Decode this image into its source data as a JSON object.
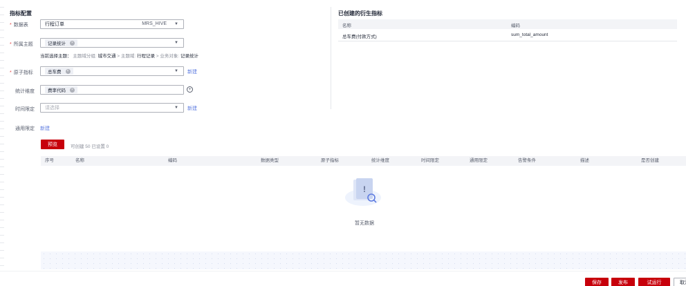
{
  "config": {
    "title": "指标配置",
    "datatable": {
      "label": "数据表",
      "value": "行程订单",
      "suffix": "MRS_HIVE"
    },
    "subject": {
      "label": "所属主题",
      "tag": "记录统计",
      "path_prefix": "当前选择主题：",
      "path": [
        {
          "k": "主题域分组:",
          "v": "城市交通"
        },
        {
          "k": "主题域:",
          "v": "行程记录"
        },
        {
          "k": "业务对象:",
          "v": "记录统计"
        }
      ]
    },
    "atomic": {
      "label": "原子指标",
      "tag": "总车费",
      "new_link": "新建"
    },
    "dimension": {
      "label": "统计维度",
      "tag": "费率代码"
    },
    "time": {
      "label": "时间限定",
      "placeholder": "请选择",
      "new_link": "新建"
    },
    "general": {
      "label": "通用限定",
      "new_link": "新建"
    },
    "preview_button": "预览",
    "count_text": "可创建 50 已设置 0"
  },
  "created": {
    "title": "已创建的衍生指标",
    "columns": [
      "名称",
      "编码"
    ],
    "rows": [
      {
        "name": "总车费(付款方式)",
        "code": "sum_total_amount"
      }
    ]
  },
  "table": {
    "columns": [
      "序号",
      "名称",
      "编码",
      "数据类型",
      "原子指标",
      "统计维度",
      "时间限定",
      "通用限定",
      "告警条件",
      "描述",
      "是否创建"
    ],
    "empty_text": "暂无数据"
  },
  "footer": {
    "save": "保存",
    "publish": "发布",
    "trial": "试运行",
    "cancel": "取消"
  },
  "colors": {
    "brand": "#c7000b",
    "link": "#5e7ce0",
    "required": "#e54545"
  }
}
